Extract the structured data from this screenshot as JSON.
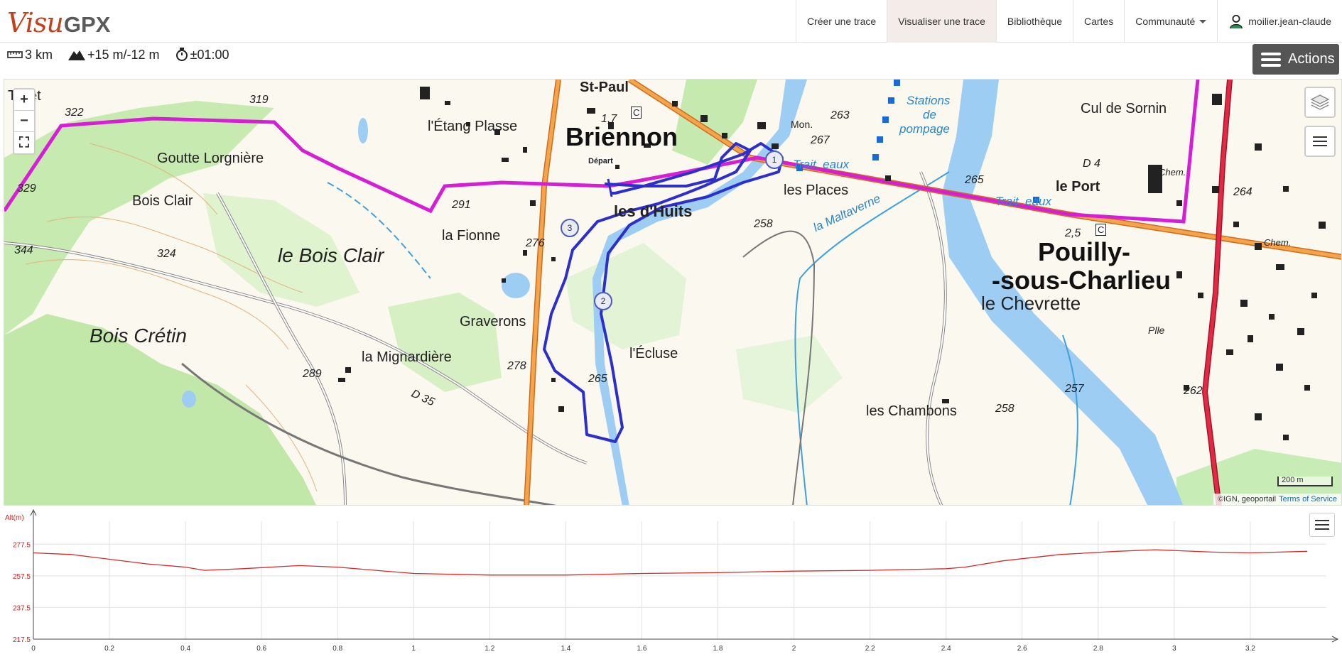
{
  "brand": {
    "visu": "Visu",
    "gpx": "GPX"
  },
  "nav": {
    "items": [
      {
        "label": "Créer une trace",
        "active": false
      },
      {
        "label": "Visualiser une trace",
        "active": true
      },
      {
        "label": "Bibliothèque",
        "active": false
      },
      {
        "label": "Cartes",
        "active": false
      }
    ],
    "community": "Communauté",
    "user": "moilier.jean-claude"
  },
  "stats": {
    "distance": "3 km",
    "elevation": "+15 m/-12 m",
    "duration": "±01:00"
  },
  "actions_label": "Actions",
  "map": {
    "zoom_in": "+",
    "zoom_out": "−",
    "fullscreen": "⛶",
    "scale": "200 m",
    "attribution": "©IGN, geoportail",
    "terms": "Terms of Service",
    "depart": "Départ",
    "markers": [
      "1",
      "2",
      "3"
    ],
    "labels": {
      "briennon": "Briennon",
      "pouilly1": "Pouilly-",
      "pouilly2": "-sous-Charlieu",
      "bois_clair": "le Bois Clair",
      "bois_cretin": "Bois Crétin",
      "huits": "les d'Huits",
      "etang": "l'Étang Plasse",
      "goutte": "Goutte Lorgnière",
      "boisclair_small": "Bois Clair",
      "fionne": "la Fionne",
      "graverons": "Graverons",
      "mignardiere": "la Mignardière",
      "ecluse": "l'Écluse",
      "places": "les Places",
      "chambons": "les Chambons",
      "chevrette": "le Chevrette",
      "cul_sornin": "Cul de Sornin",
      "le_port": "le Port",
      "st_paul": "St-Paul",
      "ollet": "Tollet",
      "stations": "Stations",
      "de": "de",
      "pompage": "pompage",
      "trait1": "Trait. eaux",
      "trait2": "Trait. eaux",
      "maltaverne": "la Maltaverne",
      "d4": "D 4",
      "d35": "D 35",
      "chem1": "Chem.",
      "chem2": "Chem.",
      "pile": "Plle",
      "mon": "Mon.",
      "c1": "C",
      "c2": "C"
    },
    "altitudes": [
      "322",
      "319",
      "329",
      "344",
      "324",
      "291",
      "276",
      "278",
      "289",
      "265",
      "263",
      "267",
      "258",
      "265",
      "264",
      "257",
      "262",
      "258",
      "1,7",
      "2,5"
    ]
  },
  "chart": {
    "y_label": "Alt(m)",
    "menu_icon": "hamburger-icon"
  },
  "chart_data": {
    "type": "line",
    "ylabel": "Alt(m)",
    "xlabel": "",
    "xlim": [
      0,
      3.4
    ],
    "ylim": [
      217.5,
      287.5
    ],
    "y_ticks": [
      "277.5",
      "257.5",
      "237.5",
      "217.5"
    ],
    "x_ticks": [
      "0",
      "0.2",
      "0.4",
      "0.6",
      "0.8",
      "1",
      "1.2",
      "1.4",
      "1.6",
      "1.8",
      "2",
      "2.2",
      "2.4",
      "2.6",
      "2.8",
      "3",
      "3.2"
    ],
    "series": [
      {
        "color": "#d42a2a",
        "x": [
          0,
          0.1,
          0.2,
          0.3,
          0.4,
          0.45,
          0.55,
          0.7,
          0.8,
          0.9,
          1.0,
          1.2,
          1.4,
          1.5,
          1.6,
          1.8,
          2.0,
          2.2,
          2.4,
          2.45,
          2.55,
          2.7,
          2.85,
          2.95,
          3.1,
          3.2,
          3.35
        ],
        "y": [
          272,
          271,
          268,
          265,
          263,
          261,
          262,
          264,
          263,
          261,
          259,
          258,
          258,
          258.5,
          259,
          259.5,
          260.5,
          261,
          262,
          263,
          267,
          271,
          273,
          274,
          272.5,
          272,
          273
        ]
      }
    ]
  },
  "colors": {
    "brand_red": "#c2411b",
    "track_blue": "#2c2fcb",
    "gr_magenta": "#d61ed6",
    "road_orange": "#f0963a",
    "road_red": "#d41e3a",
    "water": "#9dcdf2",
    "forest": "#bfe6a8"
  }
}
